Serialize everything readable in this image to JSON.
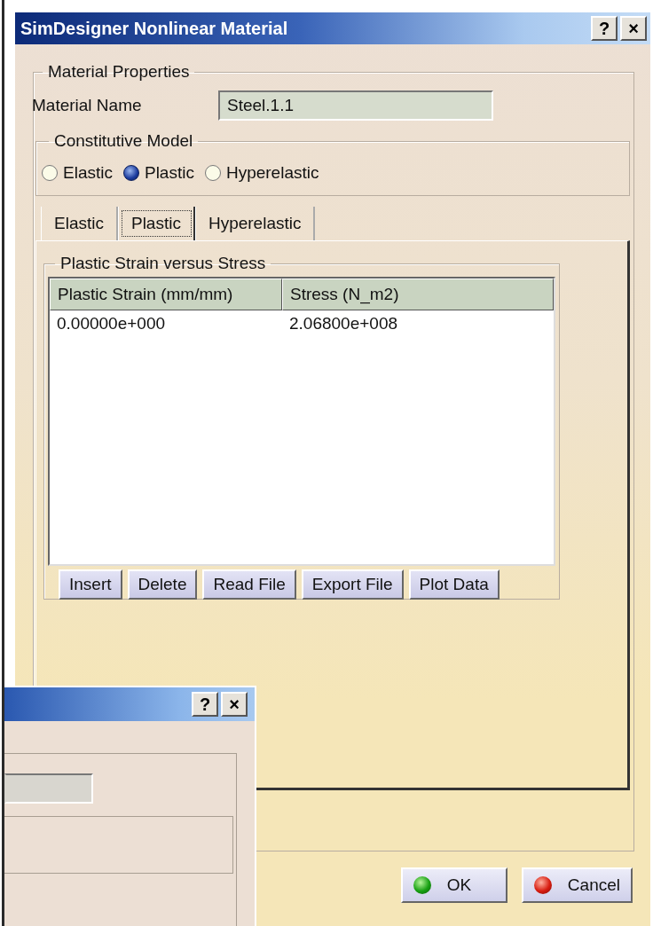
{
  "window": {
    "title": "SimDesigner Nonlinear Material",
    "help_button": "?",
    "close_button": "×"
  },
  "material_properties": {
    "legend": "Material Properties",
    "name_label": "Material Name",
    "name_value": "Steel.1.1"
  },
  "constitutive_model": {
    "legend": "Constitutive Model",
    "options": [
      {
        "label": "Elastic",
        "selected": false
      },
      {
        "label": "Plastic",
        "selected": true
      },
      {
        "label": "Hyperelastic",
        "selected": false
      }
    ]
  },
  "tabs": [
    {
      "label": "Elastic",
      "selected": false
    },
    {
      "label": "Plastic",
      "selected": true
    },
    {
      "label": "Hyperelastic",
      "selected": false
    }
  ],
  "plastic_group": {
    "legend": "Plastic Strain versus Stress",
    "table": {
      "columns": [
        "Plastic Strain (mm/mm)",
        "Stress (N_m2)"
      ],
      "rows": [
        [
          "0.00000e+000",
          "2.06800e+008"
        ]
      ]
    },
    "buttons": [
      "Insert",
      "Delete",
      "Read File",
      "Export File",
      "Plot Data"
    ]
  },
  "dialog_buttons": [
    {
      "kind": "ok",
      "label": "OK"
    },
    {
      "kind": "cancel",
      "label": "Cancel"
    }
  ],
  "background_dialog": {
    "help_button": "?",
    "close_button": "×"
  }
}
